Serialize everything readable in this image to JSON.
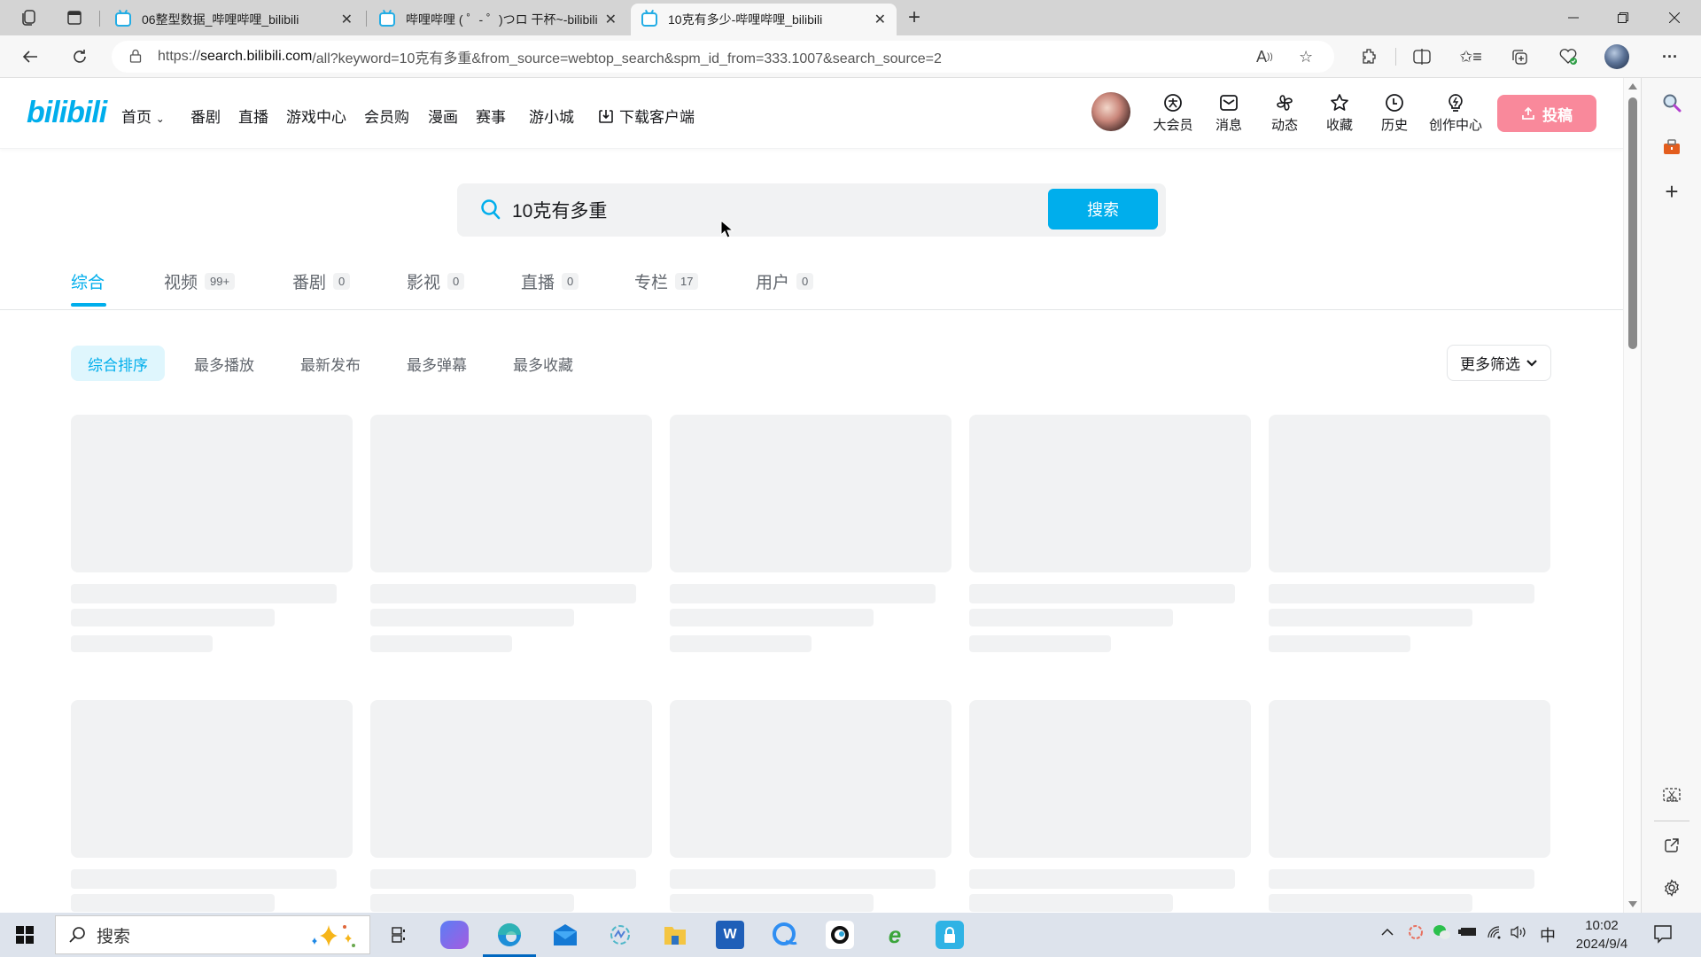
{
  "browser": {
    "tabs": [
      {
        "title": "06整型数据_哔哩哔哩_bilibili",
        "active": false
      },
      {
        "title": "哔哩哔哩 ( ゜- ゜)つロ 干杯~-bilibili",
        "active": false
      },
      {
        "title": "10克有多少-哔哩哔哩_bilibili",
        "active": true
      }
    ],
    "new_tab_label": "+",
    "url_scheme": "https://",
    "url_host": "search.bilibili.com",
    "url_rest": "/all?keyword=10克有多重&from_source=webtop_search&spm_id_from=333.1007&search_source=2",
    "icons": [
      "workspaces-icon",
      "tab-actions-icon",
      "back-icon",
      "refresh-icon",
      "lock-icon",
      "read-aloud-icon",
      "favorite-star-icon",
      "extensions-icon",
      "split-screen-icon",
      "favorites-icon",
      "collections-icon",
      "browser-essentials-icon",
      "profile-avatar",
      "more-icon"
    ]
  },
  "header": {
    "logo": "bilibili",
    "nav": [
      "首页",
      "番剧",
      "直播",
      "游戏中心",
      "会员购",
      "漫画",
      "赛事",
      "游小城",
      "下载客户端"
    ],
    "right_items": [
      "大会员",
      "消息",
      "动态",
      "收藏",
      "历史",
      "创作中心"
    ],
    "upload_label": "投稿"
  },
  "search": {
    "query": "10克有多重",
    "button_label": "搜索"
  },
  "type_tabs": [
    {
      "label": "综合",
      "count": "",
      "active": true
    },
    {
      "label": "视频",
      "count": "99+"
    },
    {
      "label": "番剧",
      "count": "0"
    },
    {
      "label": "影视",
      "count": "0"
    },
    {
      "label": "直播",
      "count": "0"
    },
    {
      "label": "专栏",
      "count": "17"
    },
    {
      "label": "用户",
      "count": "0"
    }
  ],
  "sort_options": [
    {
      "label": "综合排序",
      "active": true
    },
    {
      "label": "最多播放"
    },
    {
      "label": "最新发布"
    },
    {
      "label": "最多弹幕"
    },
    {
      "label": "最多收藏"
    }
  ],
  "more_filter_label": "更多筛选",
  "results_state": "loading-skeleton",
  "taskbar": {
    "search_placeholder": "搜索",
    "ime": "中",
    "time": "10:02",
    "date": "2024/9/4"
  },
  "colors": {
    "brand": "#00aeec",
    "upload": "#f9899b",
    "skeleton": "#f1f2f3"
  }
}
